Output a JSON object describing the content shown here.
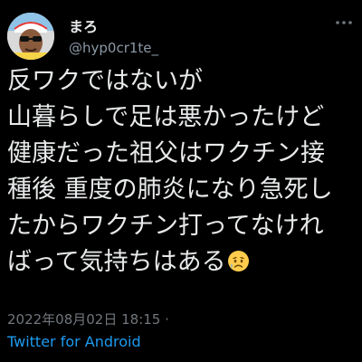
{
  "user": {
    "display_name": "まろ",
    "handle": "@hyp0cr1te_"
  },
  "tweet": {
    "lines": [
      "反ワクではないが",
      "山暮らしで足は悪かったけど",
      "健康だった祖父はワクチン接",
      "種後 重度の肺炎になり急死し",
      "たからワクチン打ってなけれ",
      "ばって気持ちはある"
    ],
    "emoji": "sad-but-relieved-face",
    "timestamp": "2022年08月02日 18:15 ·",
    "source": "Twitter for Android"
  },
  "icons": {
    "more": "more-horizontal-icon"
  },
  "colors": {
    "background": "#000000",
    "text": "#e7e9ea",
    "secondary": "#71767b",
    "link": "#1d9bf0"
  }
}
